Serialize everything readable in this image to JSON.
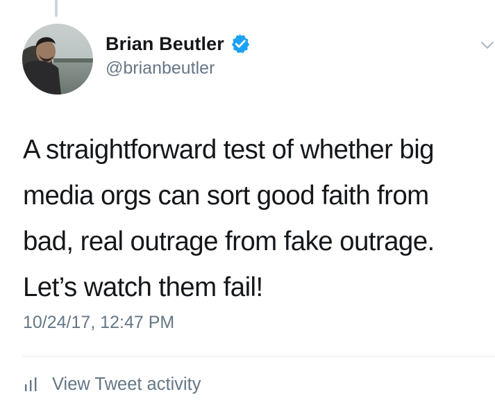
{
  "tweet": {
    "author": {
      "display_name": "Brian Beutler",
      "handle": "@brianbeutler",
      "verified": true
    },
    "text": "A straightforward test of whether big\nmedia orgs can sort good faith from\nbad, real outrage from fake outrage.\nLet’s watch them fail!",
    "timestamp": "10/24/17, 12:47 PM",
    "activity_label": "View Tweet activity"
  },
  "icons": {
    "verified": "verified-badge-icon",
    "menu": "chevron-down-icon",
    "analytics": "bar-chart-icon"
  },
  "colors": {
    "text_primary": "#14171a",
    "text_secondary": "#657786",
    "verified_blue": "#1da1f2",
    "divider": "#e1e8ed"
  }
}
